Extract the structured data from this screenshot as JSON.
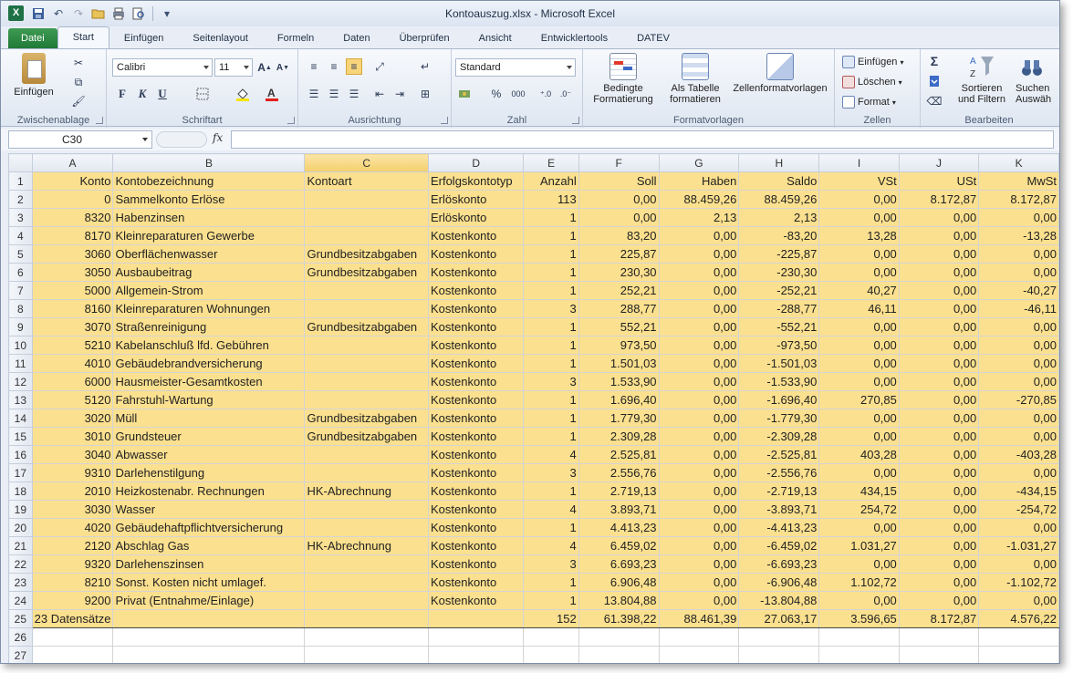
{
  "window": {
    "title": "Kontoauszug.xlsx  -  Microsoft Excel",
    "app_icon": "X"
  },
  "quick_access": {
    "icons": [
      "save-icon",
      "undo-icon",
      "redo-icon",
      "open-icon",
      "print-icon",
      "print-preview-icon",
      "customize-icon"
    ]
  },
  "tabs": [
    "Datei",
    "Start",
    "Einfügen",
    "Seitenlayout",
    "Formeln",
    "Daten",
    "Überprüfen",
    "Ansicht",
    "Entwicklertools",
    "DATEV"
  ],
  "ribbon": {
    "clipboard": {
      "label": "Zwischenablage",
      "paste": "Einfügen"
    },
    "font": {
      "label": "Schriftart",
      "font_name": "Calibri",
      "font_size": "11",
      "bold": "F",
      "italic": "K",
      "underline": "U"
    },
    "alignment": {
      "label": "Ausrichtung"
    },
    "number": {
      "label": "Zahl",
      "format": "Standard",
      "percent": "%",
      "thousands": "000"
    },
    "styles": {
      "label": "Formatvorlagen",
      "conditional": "Bedingte\nFormatierung",
      "conditional_line1": "Bedingte",
      "conditional_line2": "Formatierung",
      "as_table_line1": "Als Tabelle",
      "as_table_line2": "formatieren",
      "cell_styles": "Zellenformatvorlagen"
    },
    "cells": {
      "label": "Zellen",
      "insert": "Einfügen",
      "delete": "Löschen",
      "format": "Format"
    },
    "editing": {
      "label": "Bearbeiten",
      "sort_line1": "Sortieren",
      "sort_line2": "und Filtern",
      "find_line1": "Suchen",
      "find_line2": "Auswäh"
    }
  },
  "formula_bar": {
    "name_box": "C30",
    "fx": "fx",
    "formula": ""
  },
  "columns": [
    "A",
    "B",
    "C",
    "D",
    "E",
    "F",
    "G",
    "H",
    "I",
    "J",
    "K"
  ],
  "selected_column": "C",
  "headers": [
    "Konto",
    "Kontobezeichnung",
    "Kontoart",
    "Erfolgskontotyp",
    "Anzahl",
    "Soll",
    "Haben",
    "Saldo",
    "VSt",
    "USt",
    "MwSt"
  ],
  "rows": [
    [
      "0",
      "Sammelkonto Erlöse",
      "",
      "Erlöskonto",
      "113",
      "0,00",
      "88.459,26",
      "88.459,26",
      "0,00",
      "8.172,87",
      "8.172,87"
    ],
    [
      "8320",
      "Habenzinsen",
      "",
      "Erlöskonto",
      "1",
      "0,00",
      "2,13",
      "2,13",
      "0,00",
      "0,00",
      "0,00"
    ],
    [
      "8170",
      "Kleinreparaturen Gewerbe",
      "",
      "Kostenkonto",
      "1",
      "83,20",
      "0,00",
      "-83,20",
      "13,28",
      "0,00",
      "-13,28"
    ],
    [
      "3060",
      "Oberflächenwasser",
      "Grundbesitzabgaben",
      "Kostenkonto",
      "1",
      "225,87",
      "0,00",
      "-225,87",
      "0,00",
      "0,00",
      "0,00"
    ],
    [
      "3050",
      "Ausbaubeitrag",
      "Grundbesitzabgaben",
      "Kostenkonto",
      "1",
      "230,30",
      "0,00",
      "-230,30",
      "0,00",
      "0,00",
      "0,00"
    ],
    [
      "5000",
      "Allgemein-Strom",
      "",
      "Kostenkonto",
      "1",
      "252,21",
      "0,00",
      "-252,21",
      "40,27",
      "0,00",
      "-40,27"
    ],
    [
      "8160",
      "Kleinreparaturen Wohnungen",
      "",
      "Kostenkonto",
      "3",
      "288,77",
      "0,00",
      "-288,77",
      "46,11",
      "0,00",
      "-46,11"
    ],
    [
      "3070",
      "Straßenreinigung",
      "Grundbesitzabgaben",
      "Kostenkonto",
      "1",
      "552,21",
      "0,00",
      "-552,21",
      "0,00",
      "0,00",
      "0,00"
    ],
    [
      "5210",
      "Kabelanschluß lfd. Gebühren",
      "",
      "Kostenkonto",
      "1",
      "973,50",
      "0,00",
      "-973,50",
      "0,00",
      "0,00",
      "0,00"
    ],
    [
      "4010",
      "Gebäudebrandversicherung",
      "",
      "Kostenkonto",
      "1",
      "1.501,03",
      "0,00",
      "-1.501,03",
      "0,00",
      "0,00",
      "0,00"
    ],
    [
      "6000",
      "Hausmeister-Gesamtkosten",
      "",
      "Kostenkonto",
      "3",
      "1.533,90",
      "0,00",
      "-1.533,90",
      "0,00",
      "0,00",
      "0,00"
    ],
    [
      "5120",
      "Fahrstuhl-Wartung",
      "",
      "Kostenkonto",
      "1",
      "1.696,40",
      "0,00",
      "-1.696,40",
      "270,85",
      "0,00",
      "-270,85"
    ],
    [
      "3020",
      "Müll",
      "Grundbesitzabgaben",
      "Kostenkonto",
      "1",
      "1.779,30",
      "0,00",
      "-1.779,30",
      "0,00",
      "0,00",
      "0,00"
    ],
    [
      "3010",
      "Grundsteuer",
      "Grundbesitzabgaben",
      "Kostenkonto",
      "1",
      "2.309,28",
      "0,00",
      "-2.309,28",
      "0,00",
      "0,00",
      "0,00"
    ],
    [
      "3040",
      "Abwasser",
      "",
      "Kostenkonto",
      "4",
      "2.525,81",
      "0,00",
      "-2.525,81",
      "403,28",
      "0,00",
      "-403,28"
    ],
    [
      "9310",
      "Darlehenstilgung",
      "",
      "Kostenkonto",
      "3",
      "2.556,76",
      "0,00",
      "-2.556,76",
      "0,00",
      "0,00",
      "0,00"
    ],
    [
      "2010",
      "Heizkostenabr. Rechnungen",
      "HK-Abrechnung",
      "Kostenkonto",
      "1",
      "2.719,13",
      "0,00",
      "-2.719,13",
      "434,15",
      "0,00",
      "-434,15"
    ],
    [
      "3030",
      "Wasser",
      "",
      "Kostenkonto",
      "4",
      "3.893,71",
      "0,00",
      "-3.893,71",
      "254,72",
      "0,00",
      "-254,72"
    ],
    [
      "4020",
      "Gebäudehaftpflichtversicherung",
      "",
      "Kostenkonto",
      "1",
      "4.413,23",
      "0,00",
      "-4.413,23",
      "0,00",
      "0,00",
      "0,00"
    ],
    [
      "2120",
      "Abschlag Gas",
      "HK-Abrechnung",
      "Kostenkonto",
      "4",
      "6.459,02",
      "0,00",
      "-6.459,02",
      "1.031,27",
      "0,00",
      "-1.031,27"
    ],
    [
      "9320",
      "Darlehenszinsen",
      "",
      "Kostenkonto",
      "3",
      "6.693,23",
      "0,00",
      "-6.693,23",
      "0,00",
      "0,00",
      "0,00"
    ],
    [
      "8210",
      "Sonst. Kosten nicht umlagef.",
      "",
      "Kostenkonto",
      "1",
      "6.906,48",
      "0,00",
      "-6.906,48",
      "1.102,72",
      "0,00",
      "-1.102,72"
    ],
    [
      "9200",
      "Privat (Entnahme/Einlage)",
      "",
      "Kostenkonto",
      "1",
      "13.804,88",
      "0,00",
      "-13.804,88",
      "0,00",
      "0,00",
      "0,00"
    ]
  ],
  "total_row": [
    "23 Datensätze",
    "",
    "",
    "",
    "152",
    "61.398,22",
    "88.461,39",
    "27.063,17",
    "3.596,65",
    "8.172,87",
    "4.576,22"
  ],
  "empty_rows": [
    "26",
    "27"
  ],
  "colors": {
    "highlight": "#fbe08f",
    "selected_header": "#f4cf6b",
    "file_tab": "#1f7a36"
  }
}
